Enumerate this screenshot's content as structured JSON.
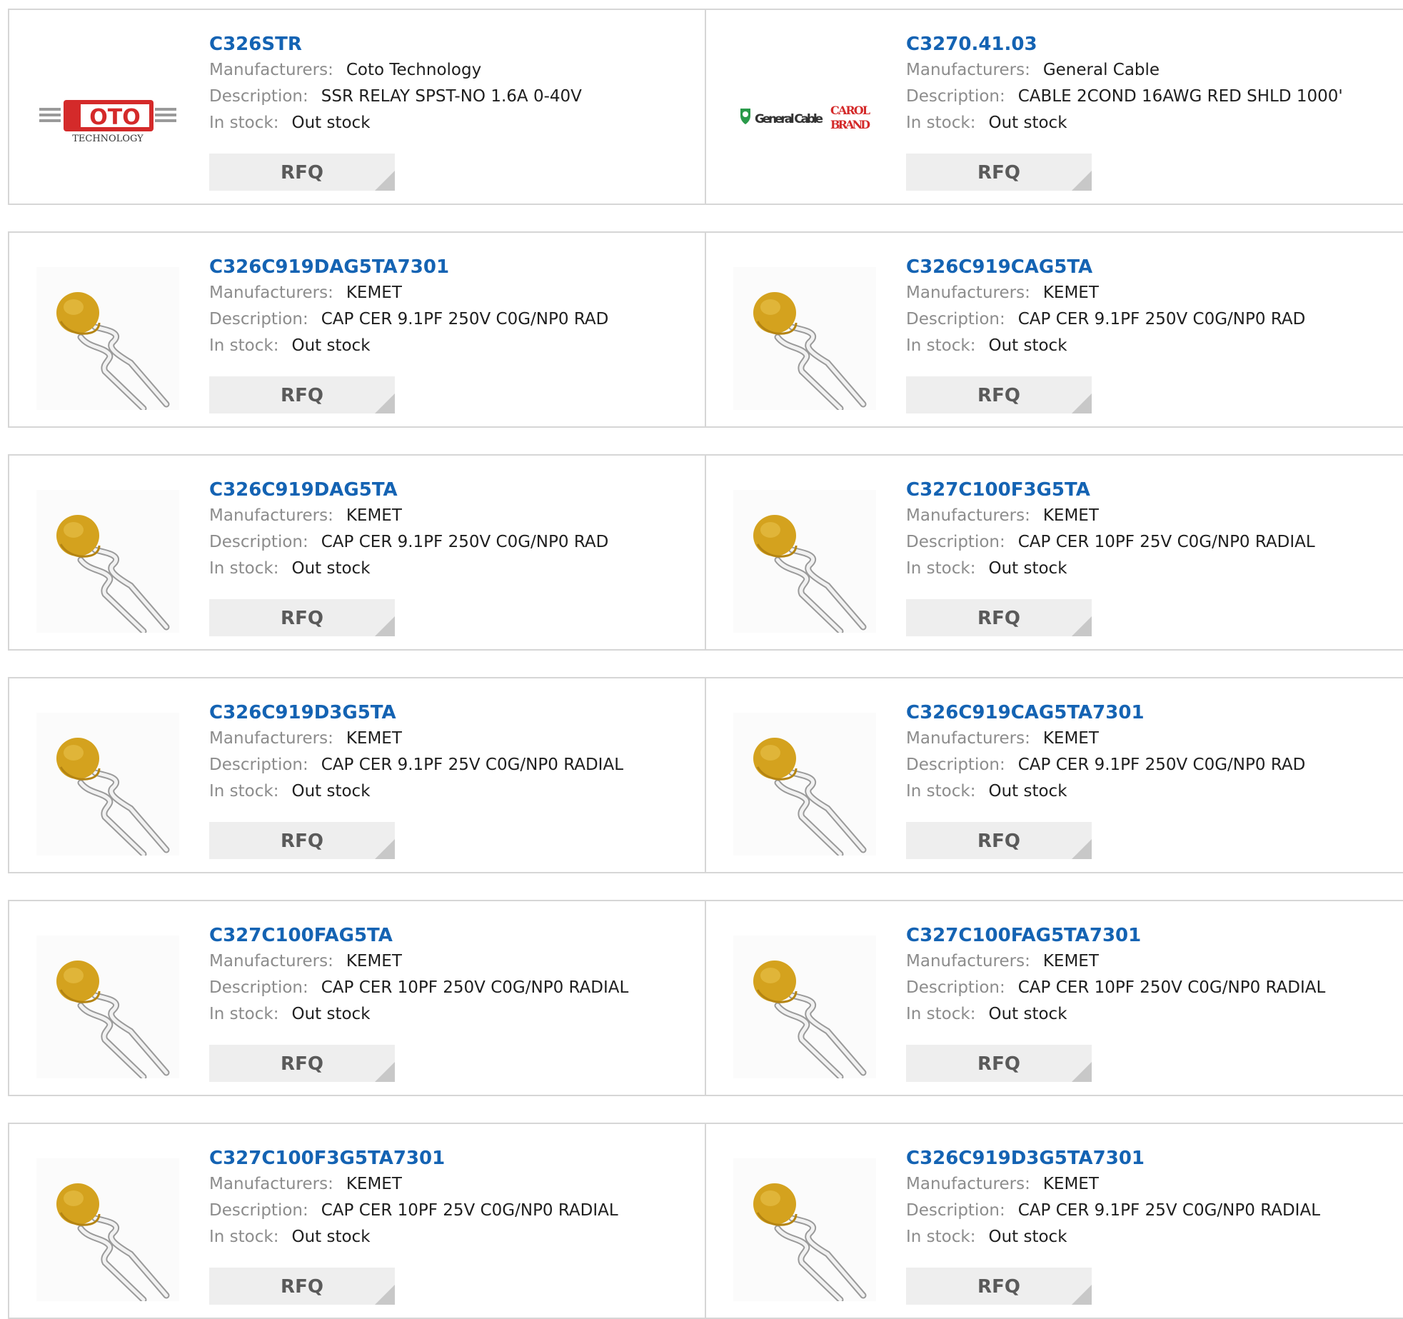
{
  "labels": {
    "manufacturers": "Manufacturers:",
    "description": "Description:",
    "in_stock": "In stock:",
    "rfq": "RFQ"
  },
  "colors": {
    "part_link": "#1463b3",
    "label": "#8c8c8c",
    "value": "#1e1e1e",
    "rfq_bg": "#eeeeee",
    "border": "#d6d6d6"
  },
  "products": [
    {
      "part": "C326STR",
      "manufacturer": "Coto Technology",
      "description": "SSR RELAY SPST-NO 1.6A 0-40V",
      "stock": "Out stock",
      "image": "coto-technology-logo"
    },
    {
      "part": "C3270.41.03",
      "manufacturer": "General Cable",
      "description": "CABLE 2COND 16AWG RED SHLD 1000'",
      "stock": "Out stock",
      "image": "general-cable-carol-brand-logo"
    },
    {
      "part": "C326C919DAG5TA7301",
      "manufacturer": "KEMET",
      "description": "CAP CER 9.1PF 250V C0G/NP0 RAD",
      "stock": "Out stock",
      "image": "ceramic-capacitor-photo"
    },
    {
      "part": "C326C919CAG5TA",
      "manufacturer": "KEMET",
      "description": "CAP CER 9.1PF 250V C0G/NP0 RAD",
      "stock": "Out stock",
      "image": "ceramic-capacitor-photo"
    },
    {
      "part": "C326C919DAG5TA",
      "manufacturer": "KEMET",
      "description": "CAP CER 9.1PF 250V C0G/NP0 RAD",
      "stock": "Out stock",
      "image": "ceramic-capacitor-photo"
    },
    {
      "part": "C327C100F3G5TA",
      "manufacturer": "KEMET",
      "description": "CAP CER 10PF 25V C0G/NP0 RADIAL",
      "stock": "Out stock",
      "image": "ceramic-capacitor-photo"
    },
    {
      "part": "C326C919D3G5TA",
      "manufacturer": "KEMET",
      "description": "CAP CER 9.1PF 25V C0G/NP0 RADIAL",
      "stock": "Out stock",
      "image": "ceramic-capacitor-photo"
    },
    {
      "part": "C326C919CAG5TA7301",
      "manufacturer": "KEMET",
      "description": "CAP CER 9.1PF 250V C0G/NP0 RAD",
      "stock": "Out stock",
      "image": "ceramic-capacitor-photo"
    },
    {
      "part": "C327C100FAG5TA",
      "manufacturer": "KEMET",
      "description": "CAP CER 10PF 250V C0G/NP0 RADIAL",
      "stock": "Out stock",
      "image": "ceramic-capacitor-photo"
    },
    {
      "part": "C327C100FAG5TA7301",
      "manufacturer": "KEMET",
      "description": "CAP CER 10PF 250V C0G/NP0 RADIAL",
      "stock": "Out stock",
      "image": "ceramic-capacitor-photo"
    },
    {
      "part": "C327C100F3G5TA7301",
      "manufacturer": "KEMET",
      "description": "CAP CER 10PF 25V C0G/NP0 RADIAL",
      "stock": "Out stock",
      "image": "ceramic-capacitor-photo"
    },
    {
      "part": "C326C919D3G5TA7301",
      "manufacturer": "KEMET",
      "description": "CAP CER 9.1PF 25V C0G/NP0 RADIAL",
      "stock": "Out stock",
      "image": "ceramic-capacitor-photo"
    }
  ]
}
